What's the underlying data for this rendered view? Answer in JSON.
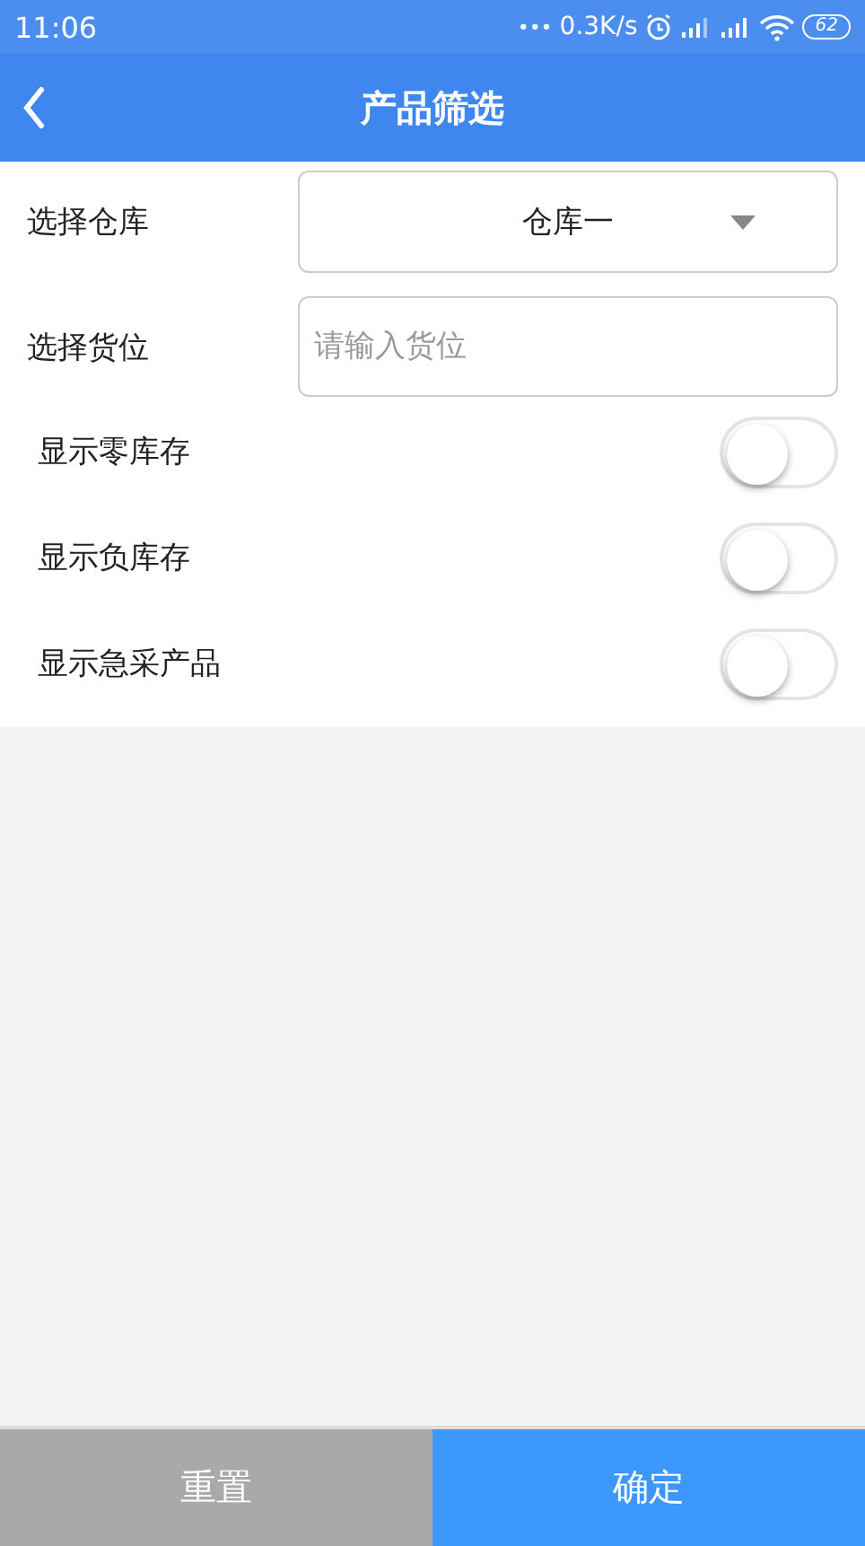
{
  "status_bar": {
    "time": "11:06",
    "dots": "•••",
    "speed": "0.3K/s",
    "battery": "62"
  },
  "header": {
    "title": "产品筛选"
  },
  "form": {
    "warehouse": {
      "label": "选择仓库",
      "value": "仓库一"
    },
    "location": {
      "label": "选择货位",
      "placeholder": "请输入货位"
    },
    "toggles": [
      {
        "label": "显示零库存",
        "on": false
      },
      {
        "label": "显示负库存",
        "on": false
      },
      {
        "label": "显示急采产品",
        "on": false
      }
    ]
  },
  "buttons": [
    {
      "label": "重置",
      "kind": "reset"
    },
    {
      "label": "确定",
      "kind": "confirm"
    }
  ]
}
